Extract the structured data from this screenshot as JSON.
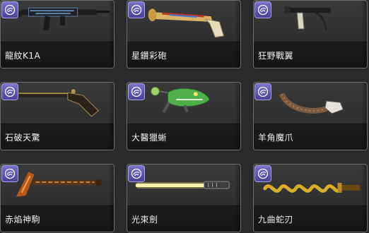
{
  "badge_icon": "shield-swirl-icon",
  "items": [
    {
      "name": "龍紋K1A",
      "icon": "rifle-icon"
    },
    {
      "name": "星鑽彩砲",
      "icon": "flintlock-blunderbuss-icon"
    },
    {
      "name": "狂野戰翼",
      "icon": "wing-pistol-icon"
    },
    {
      "name": "石破天驚",
      "icon": "flintlock-pistol-icon"
    },
    {
      "name": "大醫獵蜥",
      "icon": "lizard-gun-icon"
    },
    {
      "name": "羊角魔爪",
      "icon": "horn-claw-icon"
    },
    {
      "name": "赤焰神駒",
      "icon": "flame-sword-icon"
    },
    {
      "name": "光束劍",
      "icon": "beam-sword-icon"
    },
    {
      "name": "九曲蛇刃",
      "icon": "serpent-blade-icon"
    }
  ]
}
